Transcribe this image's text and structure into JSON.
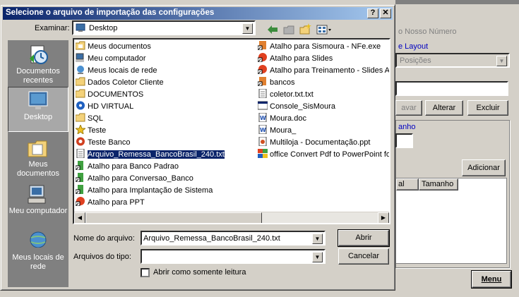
{
  "background_app": {
    "label_nosso_numero": "o Nosso Número",
    "label_layout": "e Layout",
    "select_posicoes": "Posições",
    "btn_salvar": "avar",
    "btn_alterar": "Alterar",
    "btn_excluir": "Excluir",
    "label_tamanho": "anho",
    "btn_adicionar": "Adicionar",
    "col_partial": "al",
    "col_tamanho": "Tamanho",
    "btn_menu": "Menu"
  },
  "dialog": {
    "title": "Selecione o arquivo de importação das configurações",
    "help_btn": "?",
    "close_btn": "✕",
    "look_in_label": "Examinar:",
    "look_in_value": "Desktop",
    "places": [
      {
        "label": "Documentos recentes",
        "icon": "recent-documents-icon"
      },
      {
        "label": "Desktop",
        "icon": "desktop-icon"
      },
      {
        "label": "Meus documentos",
        "icon": "my-documents-icon"
      },
      {
        "label": "Meu computador",
        "icon": "my-computer-icon"
      },
      {
        "label": "Meus locais de rede",
        "icon": "network-places-icon"
      }
    ],
    "files_col1": [
      {
        "name": "Meus documentos",
        "icon": "folder-docs"
      },
      {
        "name": "Meu computador",
        "icon": "computer"
      },
      {
        "name": "Meus locais de rede",
        "icon": "network"
      },
      {
        "name": "Dados Coletor Cliente",
        "icon": "folder"
      },
      {
        "name": "DOCUMENTOS",
        "icon": "folder"
      },
      {
        "name": "HD VIRTUAL",
        "icon": "drive"
      },
      {
        "name": "SQL",
        "icon": "folder"
      },
      {
        "name": "Teste",
        "icon": "star"
      },
      {
        "name": "Teste Banco",
        "icon": "app-red"
      },
      {
        "name": "Arquivo_Remessa_BancoBrasil_240.txt",
        "icon": "text"
      },
      {
        "name": "Atalho para Banco Padrao",
        "icon": "shortcut-green"
      },
      {
        "name": "Atalho para Conversao_Banco",
        "icon": "shortcut-green"
      },
      {
        "name": "Atalho para Implantação de Sistema",
        "icon": "shortcut-green"
      },
      {
        "name": "Atalho para PPT",
        "icon": "shortcut-red"
      }
    ],
    "files_col2": [
      {
        "name": "Atalho para Sismoura - NFe.exe",
        "icon": "shortcut-orange"
      },
      {
        "name": "Atalho para Slides",
        "icon": "shortcut-red"
      },
      {
        "name": "Atalho para Treinamento - Slides Ap",
        "icon": "shortcut-red"
      },
      {
        "name": "bancos",
        "icon": "shortcut-orange"
      },
      {
        "name": "coletor.txt.txt",
        "icon": "text"
      },
      {
        "name": "Console_SisMoura",
        "icon": "console"
      },
      {
        "name": "Moura.doc",
        "icon": "word"
      },
      {
        "name": "Moura_",
        "icon": "word"
      },
      {
        "name": "Multiloja - Documentação.ppt",
        "icon": "ppt"
      },
      {
        "name": "office Convert Pdf to PowerPoint fo",
        "icon": "app-multi"
      }
    ],
    "filename_label": "Nome do arquivo:",
    "filename_value": "Arquivo_Remessa_BancoBrasil_240.txt",
    "filetype_label": "Arquivos do tipo:",
    "filetype_value": "",
    "readonly_label": "Abrir como somente leitura",
    "open_btn": "Abrir",
    "cancel_btn": "Cancelar"
  }
}
